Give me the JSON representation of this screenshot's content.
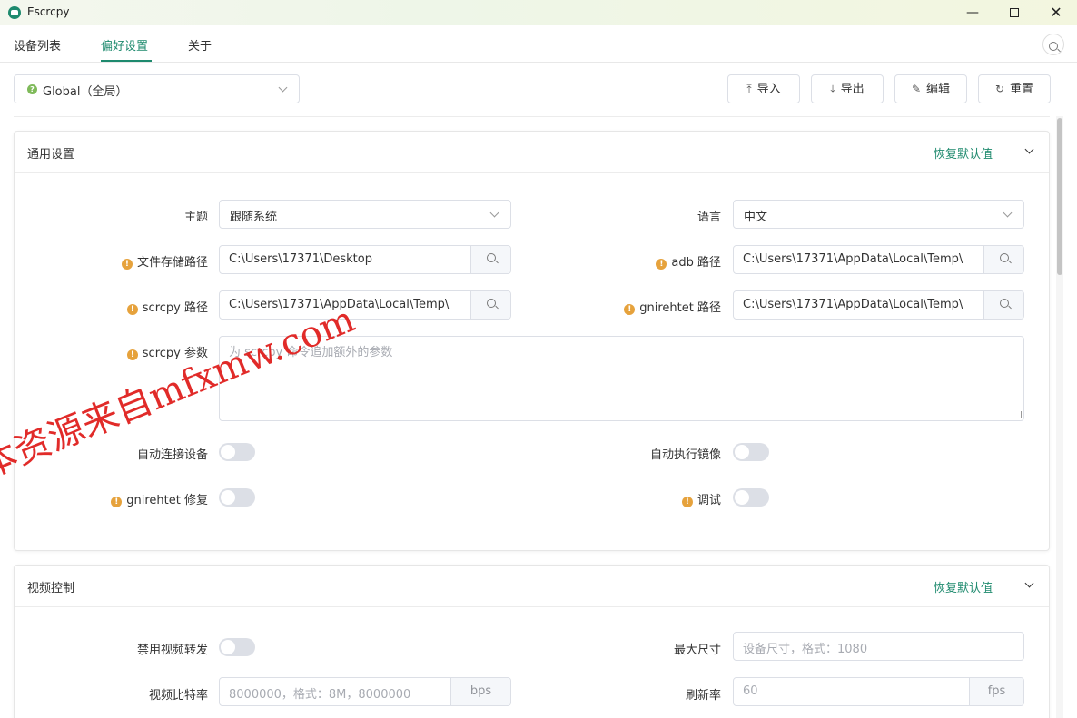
{
  "window": {
    "title": "Escrcpy",
    "minimize": "—",
    "close": "✕"
  },
  "tabs": [
    {
      "label": "设备列表"
    },
    {
      "label": "偏好设置"
    },
    {
      "label": "关于"
    }
  ],
  "preset": {
    "value": "Global（全局）"
  },
  "toolbar": {
    "import_label": "导入",
    "export_label": "导出",
    "edit_label": "编辑",
    "reset_label": "重置"
  },
  "general": {
    "title": "通用设置",
    "restore": "恢复默认值",
    "theme_label": "主题",
    "theme_value": "跟随系统",
    "language_label": "语言",
    "language_value": "中文",
    "save_path_label": "文件存储路径",
    "save_path_value": "C:\\Users\\17371\\Desktop",
    "adb_path_label": "adb 路径",
    "adb_path_value": "C:\\Users\\17371\\AppData\\Local\\Temp\\",
    "scrcpy_path_label": "scrcpy 路径",
    "scrcpy_path_value": "C:\\Users\\17371\\AppData\\Local\\Temp\\",
    "gnirehtet_path_label": "gnirehtet 路径",
    "gnirehtet_path_value": "C:\\Users\\17371\\AppData\\Local\\Temp\\",
    "scrcpy_args_label": "scrcpy 参数",
    "scrcpy_args_placeholder": "为 scrcpy 命令追加额外的参数",
    "auto_connect_label": "自动连接设备",
    "auto_connect_on": false,
    "auto_mirror_label": "自动执行镜像",
    "auto_mirror_on": false,
    "gnirehtet_fix_label": "gnirehtet 修复",
    "gnirehtet_fix_on": false,
    "debug_label": "调试",
    "debug_on": false
  },
  "video": {
    "title": "视频控制",
    "restore": "恢复默认值",
    "disable_video_label": "禁用视频转发",
    "disable_video_on": false,
    "max_size_label": "最大尺寸",
    "max_size_placeholder": "设备尺寸，格式：1080",
    "bitrate_label": "视频比特率",
    "bitrate_placeholder": "8000000，格式：8M，8000000",
    "bitrate_unit": "bps",
    "fps_label": "刷新率",
    "fps_placeholder": "60",
    "fps_unit": "fps"
  },
  "watermark": {
    "text": "本资源来自mfxmw.com"
  },
  "colors": {
    "accent": "#1e8a6e",
    "warning": "#e6a23c",
    "watermark": "#e0201e"
  }
}
